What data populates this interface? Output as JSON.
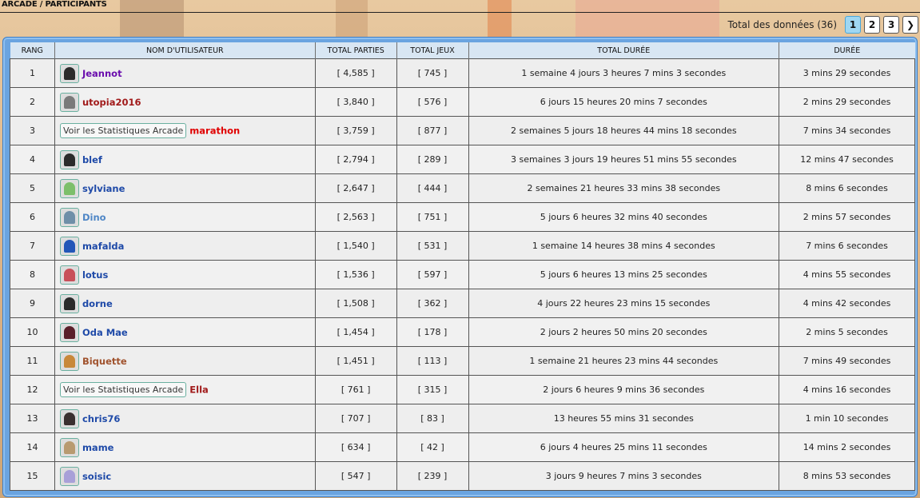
{
  "breadcrumb": "ARCADE / PARTICIPANTS",
  "pager": {
    "total_label": "Total des données (36)",
    "pages": [
      "1",
      "2",
      "3"
    ],
    "active_page": "1",
    "next_label": "❯"
  },
  "table": {
    "headers": {
      "rank": "RANG",
      "username": "NOM D'UTILISATEUR",
      "total_parties": "TOTAL PARTIES",
      "total_jeux": "TOTAL JEUX",
      "total_duree": "TOTAL DURÉE",
      "duree": "DURÉE"
    },
    "rows": [
      {
        "rank": "1",
        "name": "Jeannot",
        "name_color": "#6a0dad",
        "avatar": "silhouette",
        "broken_alt": "",
        "parties": "[ 4,585 ]",
        "jeux": "[ 745 ]",
        "total_duree": "1 semaine 4 jours 3 heures 7 mins 3 secondes",
        "duree": "3 mins 29 secondes"
      },
      {
        "rank": "2",
        "name": "utopia2016",
        "name_color": "#a11a1a",
        "avatar": "photo-gray",
        "broken_alt": "",
        "parties": "[ 3,840 ]",
        "jeux": "[ 576 ]",
        "total_duree": "6 jours 15 heures 20 mins 7 secondes",
        "duree": "2 mins 29 secondes"
      },
      {
        "rank": "3",
        "name": "marathon",
        "name_color": "#e00000",
        "avatar": "broken",
        "broken_alt": "Voir les Statistiques Arcade",
        "parties": "[ 3,759 ]",
        "jeux": "[ 877 ]",
        "total_duree": "2 semaines 5 jours 18 heures 44 mins 18 secondes",
        "duree": "7 mins 34 secondes"
      },
      {
        "rank": "4",
        "name": "blef",
        "name_color": "#1f4aa8",
        "avatar": "silhouette",
        "broken_alt": "",
        "parties": "[ 2,794 ]",
        "jeux": "[ 289 ]",
        "total_duree": "3 semaines 3 jours 19 heures 51 mins 55 secondes",
        "duree": "12 mins 47 secondes"
      },
      {
        "rank": "5",
        "name": "sylviane",
        "name_color": "#1f4aa8",
        "avatar": "green",
        "broken_alt": "",
        "parties": "[ 2,647 ]",
        "jeux": "[ 444 ]",
        "total_duree": "2 semaines 21 heures 33 mins 38 secondes",
        "duree": "8 mins 6 secondes"
      },
      {
        "rank": "6",
        "name": "Dino",
        "name_color": "#4f86c6",
        "avatar": "sky",
        "broken_alt": "",
        "parties": "[ 2,563 ]",
        "jeux": "[ 751 ]",
        "total_duree": "5 jours 6 heures 32 mins 40 secondes",
        "duree": "2 mins 57 secondes"
      },
      {
        "rank": "7",
        "name": "mafalda",
        "name_color": "#1f4aa8",
        "avatar": "blue",
        "broken_alt": "",
        "parties": "[ 1,540 ]",
        "jeux": "[ 531 ]",
        "total_duree": "1 semaine 14 heures 38 mins 4 secondes",
        "duree": "7 mins 6 secondes"
      },
      {
        "rank": "8",
        "name": "lotus",
        "name_color": "#1f4aa8",
        "avatar": "pink",
        "broken_alt": "",
        "parties": "[ 1,536 ]",
        "jeux": "[ 597 ]",
        "total_duree": "5 jours 6 heures 13 mins 25 secondes",
        "duree": "4 mins 55 secondes"
      },
      {
        "rank": "9",
        "name": "dorne",
        "name_color": "#1f4aa8",
        "avatar": "silhouette",
        "broken_alt": "",
        "parties": "[ 1,508 ]",
        "jeux": "[ 362 ]",
        "total_duree": "4 jours 22 heures 23 mins 15 secondes",
        "duree": "4 mins 42 secondes"
      },
      {
        "rank": "10",
        "name": "Oda Mae",
        "name_color": "#1f4aa8",
        "avatar": "dark",
        "broken_alt": "",
        "parties": "[ 1,454 ]",
        "jeux": "[ 178 ]",
        "total_duree": "2 jours 2 heures 50 mins 20 secondes",
        "duree": "2 mins 5 secondes"
      },
      {
        "rank": "11",
        "name": "Biquette",
        "name_color": "#a0522d",
        "avatar": "goat",
        "broken_alt": "",
        "parties": "[ 1,451 ]",
        "jeux": "[ 113 ]",
        "total_duree": "1 semaine 21 heures 23 mins 44 secondes",
        "duree": "7 mins 49 secondes"
      },
      {
        "rank": "12",
        "name": "Ella",
        "name_color": "#a11a1a",
        "avatar": "broken",
        "broken_alt": "Voir les Statistiques Arcade",
        "parties": "[ 761 ]",
        "jeux": "[ 315 ]",
        "total_duree": "2 jours 6 heures 9 mins 36 secondes",
        "duree": "4 mins 16 secondes"
      },
      {
        "rank": "13",
        "name": "chris76",
        "name_color": "#1f4aa8",
        "avatar": "dog",
        "broken_alt": "",
        "parties": "[ 707 ]",
        "jeux": "[ 83 ]",
        "total_duree": "13 heures 55 mins 31 secondes",
        "duree": "1 min 10 secondes"
      },
      {
        "rank": "14",
        "name": "mame",
        "name_color": "#1f4aa8",
        "avatar": "beige",
        "broken_alt": "",
        "parties": "[ 634 ]",
        "jeux": "[ 42 ]",
        "total_duree": "6 jours 4 heures 25 mins 11 secondes",
        "duree": "14 mins 2 secondes"
      },
      {
        "rank": "15",
        "name": "soisic",
        "name_color": "#1f4aa8",
        "avatar": "lilac",
        "broken_alt": "",
        "parties": "[ 547 ]",
        "jeux": "[ 239 ]",
        "total_duree": "3 jours 9 heures 7 mins 3 secondes",
        "duree": "8 mins 53 secondes"
      }
    ]
  },
  "avatar_colors": {
    "silhouette": "#2b2b2b",
    "photo-gray": "#7a7a7a",
    "green": "#7cbf6a",
    "sky": "#6f8fa8",
    "blue": "#2257b8",
    "pink": "#c8505a",
    "dark": "#5a1f2a",
    "goat": "#c8883a",
    "dog": "#3a3030",
    "beige": "#b89a70",
    "lilac": "#a8a0d8"
  }
}
